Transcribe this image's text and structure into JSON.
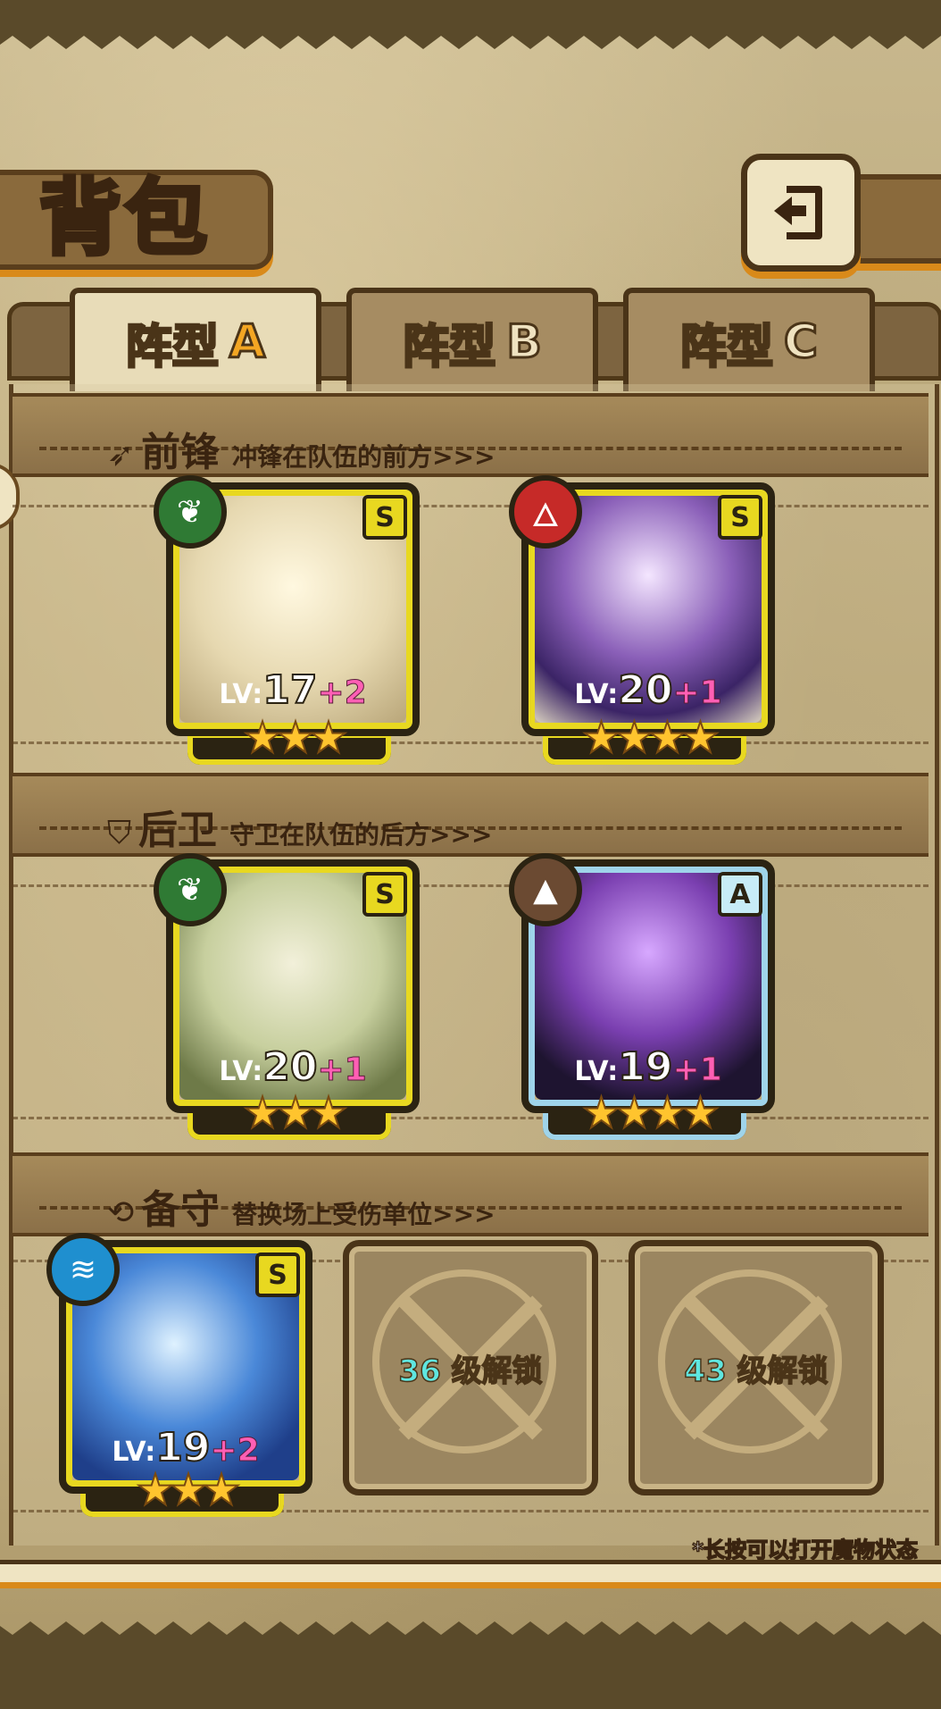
{
  "title": "背包",
  "tabs": [
    {
      "prefix": "阵型",
      "letter": "A",
      "active": true
    },
    {
      "prefix": "阵型",
      "letter": "B",
      "active": false
    },
    {
      "prefix": "阵型",
      "letter": "C",
      "active": false
    }
  ],
  "sections": {
    "front": {
      "title": "前锋",
      "desc": "冲锋在队伍的前方>>>"
    },
    "back": {
      "title": "后卫",
      "desc": "守卫在队伍的后方>>>"
    },
    "reserve": {
      "title": "备守",
      "desc": "替换场上受伤单位>>>"
    }
  },
  "units": [
    {
      "lv_label": "LV:",
      "level": "17",
      "plus": "+2",
      "rank": "S",
      "element": "leaf-icon",
      "stars": 3,
      "frame": "gold"
    },
    {
      "lv_label": "LV:",
      "level": "20",
      "plus": "+1",
      "rank": "S",
      "element": "fire-icon",
      "stars": 4,
      "frame": "gold"
    },
    {
      "lv_label": "LV:",
      "level": "20",
      "plus": "+1",
      "rank": "S",
      "element": "leaf-icon",
      "stars": 3,
      "frame": "gold"
    },
    {
      "lv_label": "LV:",
      "level": "19",
      "plus": "+1",
      "rank": "A",
      "element": "earth-icon",
      "stars": 4,
      "frame": "blue"
    },
    {
      "lv_label": "LV:",
      "level": "19",
      "plus": "+2",
      "rank": "S",
      "element": "water-icon",
      "stars": 3,
      "frame": "gold"
    }
  ],
  "locked_slots": [
    {
      "level": "36",
      "text": "级解锁"
    },
    {
      "level": "43",
      "text": "级解锁"
    }
  ],
  "hint": "*长按可以打开魔物状态",
  "colors": {
    "star": "#ffc42e",
    "plus": "#ff5fb4",
    "unlock_num": "#5fe6e0",
    "accent_orange": "#d98a1a"
  }
}
